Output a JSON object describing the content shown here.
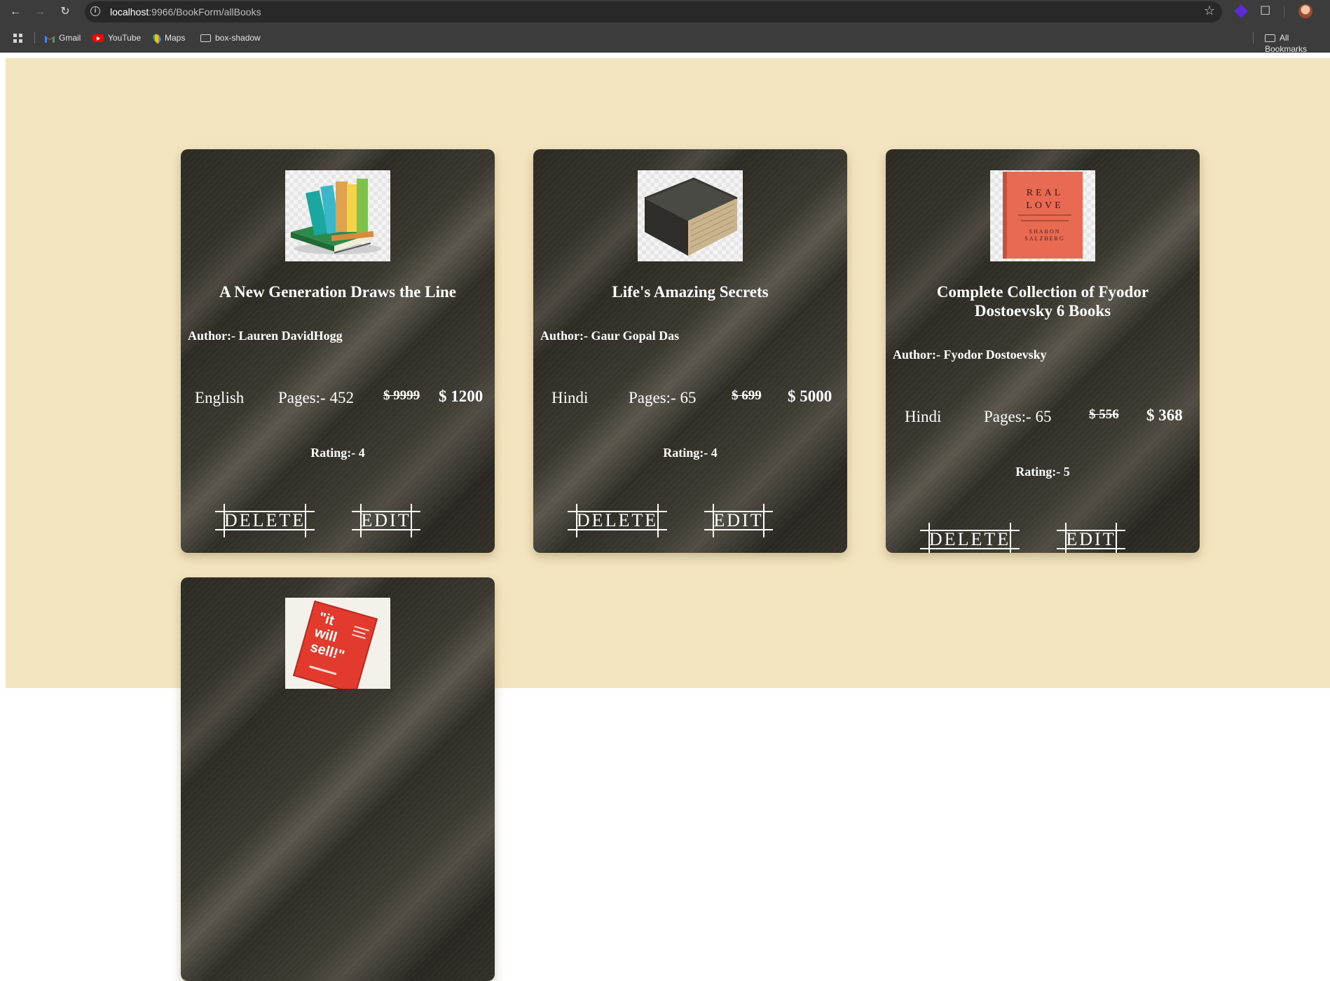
{
  "browser": {
    "url_host": "localhost",
    "url_path": ":9966/BookForm/allBooks",
    "bookmarks": [
      {
        "label": "Gmail",
        "icon": "gmail-icon"
      },
      {
        "label": "YouTube",
        "icon": "youtube-icon"
      },
      {
        "label": "Maps",
        "icon": "maps-icon"
      },
      {
        "label": "box-shadow",
        "icon": "folder-icon"
      }
    ],
    "all_bookmarks": "All Bookmarks"
  },
  "books": [
    {
      "title": "A New Generation Draws the Line",
      "author": "Author:- Lauren DavidHogg",
      "language": "English",
      "pages": "Pages:- 452",
      "original_price": "$ 9999",
      "price": "$ 1200",
      "rating": "Rating:- 4",
      "delete_label": "DELETE",
      "edit_label": "EDIT",
      "cover": "stacked-books-illustration"
    },
    {
      "title": "Life's Amazing Secrets",
      "author": "Author:- Gaur Gopal Das",
      "language": "Hindi",
      "pages": "Pages:- 65",
      "original_price": "$ 699",
      "price": "$ 5000",
      "rating": "Rating:- 4",
      "delete_label": "DELETE",
      "edit_label": "EDIT",
      "cover": "old-book-photo"
    },
    {
      "title": "Complete Collection of Fyodor Dostoevsky 6 Books",
      "author": "Author:- Fyodor Dostoevsky",
      "language": "Hindi",
      "pages": "Pages:- 65",
      "original_price": "$ 556",
      "price": "$ 368",
      "rating": "Rating:- 5",
      "delete_label": "DELETE",
      "edit_label": "EDIT",
      "cover": "real-love-cover",
      "cover_text": [
        "REAL",
        "LOVE",
        "SHARON",
        "SALZBERG"
      ]
    },
    {
      "cover": "it-will-sell-cover",
      "cover_text": [
        "\"it",
        "will",
        "sell!\""
      ]
    }
  ],
  "colors": {
    "page_bg": "#f3e5bf",
    "card_bg": "#2f2c26",
    "chrome_bg": "#3c3c3c"
  }
}
